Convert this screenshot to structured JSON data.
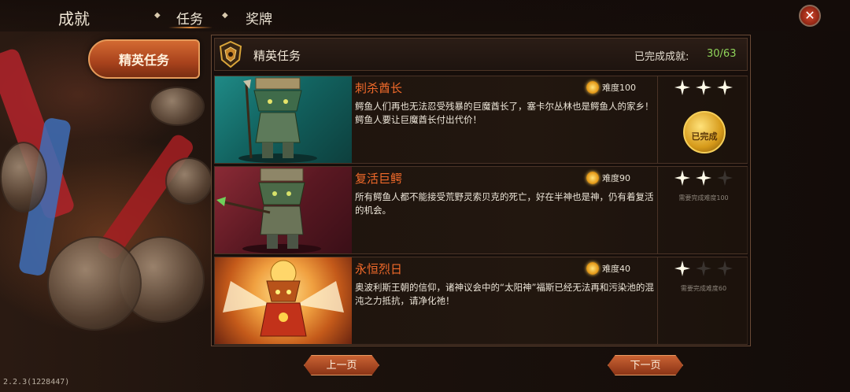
{
  "header": {
    "title": "成就",
    "tabs": [
      {
        "label": "任务",
        "active": true
      },
      {
        "label": "奖牌",
        "active": false
      }
    ],
    "close_icon": "close-icon"
  },
  "sidebar": {
    "items": [
      {
        "label": "精英任务",
        "active": true
      }
    ]
  },
  "panel": {
    "title": "精英任务",
    "progress_label": "已完成成就:",
    "progress_value": "30/63"
  },
  "missions": [
    {
      "name": "刺杀酋长",
      "difficulty": "难度100",
      "description": "鳄鱼人们再也无法忍受残暴的巨魔酋长了，塞卡尔丛林也是鳄鱼人的家乡！鳄鱼人要让巨魔酋长付出代价！",
      "stars_earned": 3,
      "stars_total": 3,
      "medal": "已完成",
      "requirement": ""
    },
    {
      "name": "复活巨鳄",
      "difficulty": "难度90",
      "description": "所有鳄鱼人都不能接受荒野灵索贝克的死亡，好在半神也是神，仍有着复活的机会。",
      "stars_earned": 2,
      "stars_total": 3,
      "medal": "",
      "requirement": "需要完成难度100"
    },
    {
      "name": "永恒烈日",
      "difficulty": "难度40",
      "description": "奥波利斯王朝的信仰，诸神议会中的“太阳神”福斯已经无法再和污染池的混沌之力抵抗，请净化祂！",
      "stars_earned": 1,
      "stars_total": 3,
      "medal": "",
      "requirement": "需要完成难度60"
    }
  ],
  "pager": {
    "prev": "上一页",
    "next": "下一页"
  },
  "version": "2.2.3(1228447)",
  "colors": {
    "accent": "#f26a2a",
    "progress": "#8fd45a",
    "button": "#c96233"
  }
}
